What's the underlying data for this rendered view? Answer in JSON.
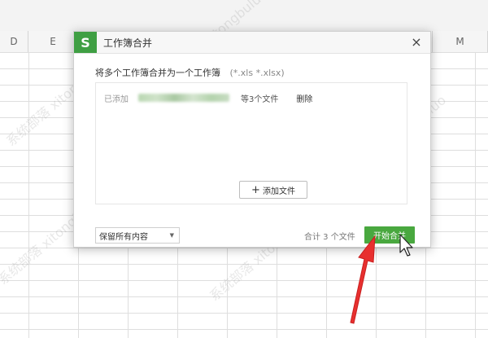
{
  "sheet": {
    "columns": [
      "D",
      "E",
      "M"
    ]
  },
  "dialog": {
    "app_logo": "S",
    "title": "工作簿合并",
    "close_glyph": "×",
    "description": "将多个工作簿合并为一个工作簿",
    "extensions": "(*.xls *.xlsx)",
    "file_row": {
      "label": "已添加",
      "count": "等3个文件",
      "delete": "删除"
    },
    "add_file": {
      "icon": "plus-icon",
      "label": "添加文件"
    },
    "footer": {
      "keep_option": "保留所有内容",
      "total": "合计 3 个文件",
      "merge_button": "开始合并"
    }
  },
  "colors": {
    "accent_green": "#49a83f",
    "logo_green": "#3f9f43",
    "arrow_red": "#e8302f"
  },
  "watermark": "系统部落 xitongbuluo"
}
